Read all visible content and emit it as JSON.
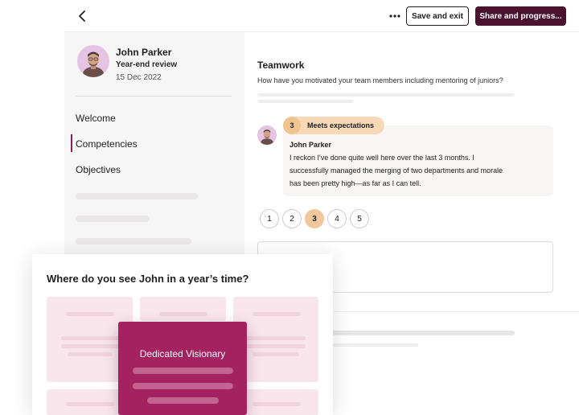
{
  "header": {
    "save_label": "Save and exit",
    "share_label": "Share and progress..."
  },
  "review": {
    "name": "John Parker",
    "type": "Year-end review",
    "date": "15 Dec 2022"
  },
  "nav": {
    "items": [
      {
        "label": "Welcome"
      },
      {
        "label": "Competencies"
      },
      {
        "label": "Objectives"
      }
    ],
    "active": "Competencies"
  },
  "question": {
    "title": "Teamwork",
    "text": "How have you motivated your team members including mentoring of juniors?"
  },
  "answer": {
    "rating_number": "3",
    "rating_label": "Meets expectations",
    "author": "John Parker",
    "lines": [
      "I reckon I've done quite well here over the last 3 months. I",
      "successfully managed the merging of two departments and morale",
      "has been pretty high—as far as I can tell."
    ]
  },
  "rating_scale": {
    "options": [
      "1",
      "2",
      "3",
      "4",
      "5"
    ],
    "selected": "3"
  },
  "popup": {
    "title": "Where do you see John in a year’s time?",
    "featured_label": "Dedicated Visionary"
  },
  "colors": {
    "primary": "#4a1130",
    "accent": "#a3225f",
    "rating": "#f0c89c",
    "tile": "#f8e6ec"
  }
}
